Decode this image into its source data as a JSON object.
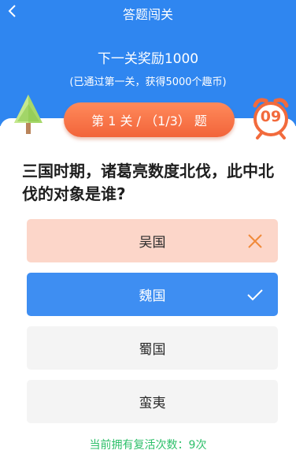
{
  "header": {
    "title": "答题闯关",
    "reward_title": "下一关奖励1000",
    "reward_sub": "(已通过第一关，获得5000个趣币)"
  },
  "level": {
    "label": "第 1 关 / （1/3） 题"
  },
  "timer": {
    "value": "09"
  },
  "question": {
    "text": "三国时期，诸葛亮数度北伐，此中北伐的对象是谁?"
  },
  "options": [
    {
      "label": "吴国",
      "state": "wrong"
    },
    {
      "label": "魏国",
      "state": "correct"
    },
    {
      "label": "蜀国",
      "state": "default"
    },
    {
      "label": "蛮夷",
      "state": "default"
    }
  ],
  "footer": {
    "revive_text": "当前拥有复活次数：9次"
  },
  "colors": {
    "primary": "#2f86f0",
    "accent": "#f2643a",
    "wrong_bg": "#fcd6c9",
    "correct_bg": "#3e8ef2",
    "revive_text": "#2fc06b"
  },
  "icons": {
    "back": "chevron-left-icon",
    "tree": "tree-icon",
    "timer": "alarm-clock-icon",
    "wrong_mark": "cross-icon",
    "correct_mark": "check-icon"
  }
}
